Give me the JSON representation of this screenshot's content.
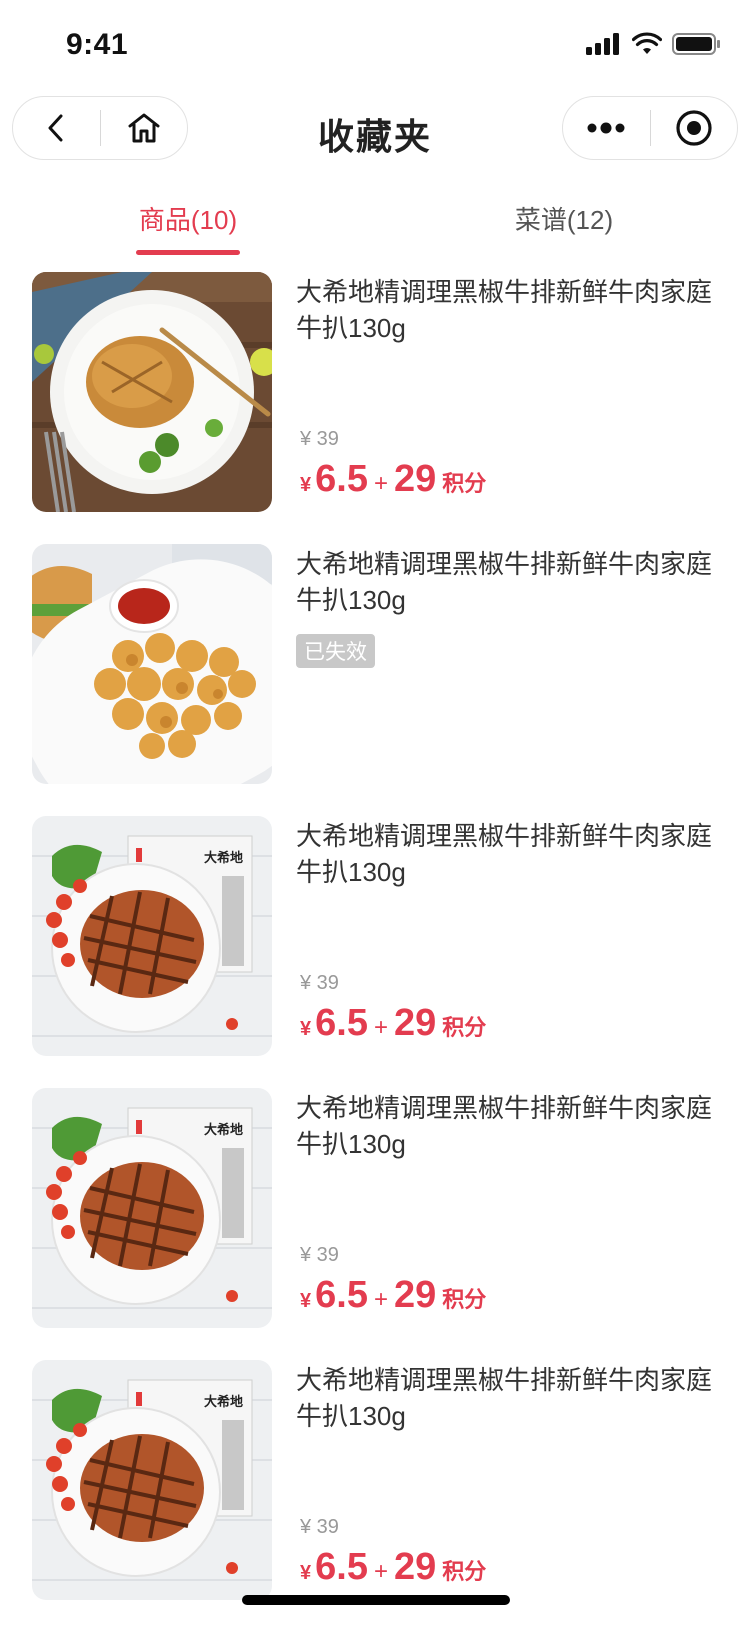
{
  "status_bar": {
    "time": "9:41"
  },
  "navbar": {
    "title": "收藏夹"
  },
  "tabs": [
    {
      "label": "商品(10)",
      "active": true
    },
    {
      "label": "菜谱(12)",
      "active": false
    }
  ],
  "colors": {
    "accent": "#e33c4f",
    "muted": "#999999",
    "badge_bg": "#c8c8c8"
  },
  "items": [
    {
      "title": "大希地精调理黑椒牛排新鲜牛肉家庭牛扒130g",
      "original_price": "¥ 39",
      "currency": "¥",
      "cash": "6.5",
      "plus": "+",
      "points": "29",
      "points_label": "积分",
      "image": "chicken-steak-plate"
    },
    {
      "title": "大希地精调理黑椒牛排新鲜牛肉家庭牛扒130g",
      "status": "已失效",
      "image": "popcorn-chicken-plate"
    },
    {
      "title": "大希地精调理黑椒牛排新鲜牛肉家庭牛扒130g",
      "original_price": "¥ 39",
      "currency": "¥",
      "cash": "6.5",
      "plus": "+",
      "points": "29",
      "points_label": "积分",
      "image": "beef-steak-package",
      "package_brand": "大希地"
    },
    {
      "title": "大希地精调理黑椒牛排新鲜牛肉家庭牛扒130g",
      "original_price": "¥ 39",
      "currency": "¥",
      "cash": "6.5",
      "plus": "+",
      "points": "29",
      "points_label": "积分",
      "image": "beef-steak-package",
      "package_brand": "大希地"
    },
    {
      "title": "大希地精调理黑椒牛排新鲜牛肉家庭牛扒130g",
      "original_price": "¥ 39",
      "currency": "¥",
      "cash": "6.5",
      "plus": "+",
      "points": "29",
      "points_label": "积分",
      "image": "beef-steak-package",
      "package_brand": "大希地"
    }
  ]
}
